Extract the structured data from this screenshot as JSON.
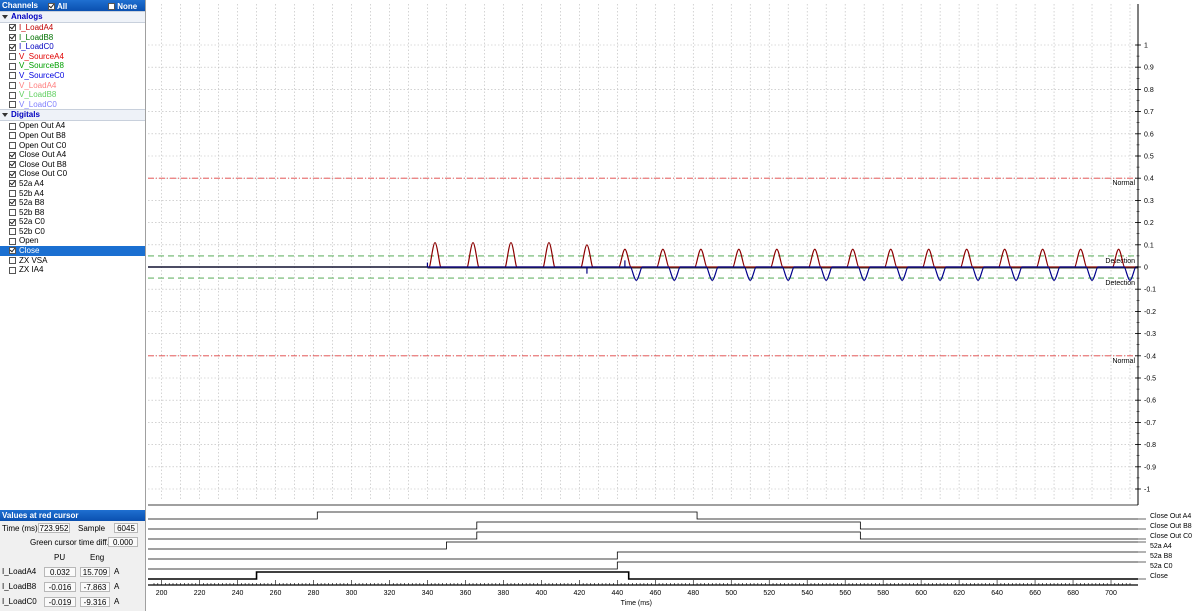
{
  "channels_panel": {
    "title": "Channels",
    "all_label": "All",
    "none_label": "None",
    "analogs_label": "Analogs",
    "analogs": [
      {
        "label": "I_LoadA4",
        "color": "#c00000",
        "checked": true
      },
      {
        "label": "I_LoadB8",
        "color": "#007000",
        "checked": true
      },
      {
        "label": "I_LoadC0",
        "color": "#0000c0",
        "checked": true
      },
      {
        "label": "V_SourceA4",
        "color": "#e00000",
        "checked": false
      },
      {
        "label": "V_SourceB8",
        "color": "#00a000",
        "checked": false
      },
      {
        "label": "V_SourceC0",
        "color": "#0000e0",
        "checked": false
      },
      {
        "label": "V_LoadA4",
        "color": "#ff8080",
        "checked": false
      },
      {
        "label": "V_LoadB8",
        "color": "#60d060",
        "checked": false
      },
      {
        "label": "V_LoadC0",
        "color": "#8080ff",
        "checked": false
      }
    ],
    "digitals_label": "Digitals",
    "digitals": [
      {
        "label": "Open Out A4",
        "checked": false
      },
      {
        "label": "Open Out B8",
        "checked": false
      },
      {
        "label": "Open Out C0",
        "checked": false
      },
      {
        "label": "Close Out A4",
        "checked": true
      },
      {
        "label": "Close Out B8",
        "checked": true
      },
      {
        "label": "Close Out C0",
        "checked": true
      },
      {
        "label": "52a A4",
        "checked": true
      },
      {
        "label": "52b A4",
        "checked": false
      },
      {
        "label": "52a B8",
        "checked": true
      },
      {
        "label": "52b B8",
        "checked": false
      },
      {
        "label": "52a C0",
        "checked": true
      },
      {
        "label": "52b C0",
        "checked": false
      },
      {
        "label": "Open",
        "checked": false
      },
      {
        "label": "Close",
        "checked": true,
        "selected": true
      },
      {
        "label": "ZX VSA",
        "checked": false
      },
      {
        "label": "ZX IA4",
        "checked": false
      }
    ]
  },
  "values_panel": {
    "title": "Values at red cursor",
    "time_label": "Time (ms)",
    "time_value": "723.952",
    "sample_label": "Sample",
    "sample_value": "6045",
    "green_diff_label": "Green cursor time diff.",
    "green_diff_value": "0.000",
    "pu_header": "PU",
    "eng_header": "Eng",
    "rows": [
      {
        "name": "I_LoadA4",
        "pu": "0.032",
        "eng": "15.709",
        "unit": "A"
      },
      {
        "name": "I_LoadB8",
        "pu": "-0.016",
        "eng": "-7.863",
        "unit": "A"
      },
      {
        "name": "I_LoadC0",
        "pu": "-0.019",
        "eng": "-9.316",
        "unit": "A"
      }
    ]
  },
  "chart_data": {
    "type": "line",
    "xlabel": "Time (ms)",
    "x_ticks": [
      200,
      220,
      240,
      260,
      280,
      300,
      320,
      340,
      360,
      380,
      400,
      420,
      440,
      460,
      480,
      500,
      520,
      540,
      560,
      580,
      600,
      620,
      640,
      660,
      680,
      700
    ],
    "xlim": [
      196,
      710
    ],
    "y_ticks": [
      "1",
      "0.9",
      "0.8",
      "0.7",
      "0.6",
      "0.5",
      "0.4",
      "0.3",
      "0.2",
      "0.1",
      "0",
      "-0.1",
      "-0.2",
      "-0.3",
      "-0.4",
      "-0.5",
      "-0.6",
      "-0.7",
      "-0.8",
      "-0.9",
      "-1"
    ],
    "ylim": [
      -1.05,
      1.08
    ],
    "grid": true,
    "threshold_lines": [
      {
        "label": "Normal",
        "value": 0.4,
        "color": "#e04040",
        "style": "dash-dot"
      },
      {
        "label": "Detection",
        "value": 0.05,
        "color": "#40a040",
        "style": "dash"
      },
      {
        "label": "Detection",
        "value": -0.05,
        "color": "#40a040",
        "style": "dash"
      },
      {
        "label": "Normal",
        "value": -0.4,
        "color": "#e04040",
        "style": "dash-dot"
      }
    ],
    "series": [
      {
        "name": "I_LoadA4",
        "color": "#8b0000",
        "pulse_times": [
          344,
          364,
          384,
          404,
          424,
          444,
          464,
          484,
          504,
          524,
          544,
          564,
          584,
          604,
          624,
          644,
          664,
          684,
          704
        ],
        "pulse_heights": [
          0.11,
          0.11,
          0.11,
          0.11,
          0.1,
          0.08,
          0.08,
          0.08,
          0.08,
          0.08,
          0.08,
          0.08,
          0.08,
          0.08,
          0.08,
          0.08,
          0.08,
          0.08,
          0.08
        ]
      },
      {
        "name": "I_LoadB8",
        "color": "#303030"
      },
      {
        "name": "I_LoadC0",
        "color": "#00008b",
        "neg_pulse_times": [
          450,
          470,
          490,
          510,
          530,
          550,
          570,
          590,
          610,
          630,
          650,
          670,
          690,
          710
        ],
        "neg_pulse_depth": -0.06
      }
    ],
    "digital_traces": [
      {
        "label": "Close Out A4",
        "transitions": [
          [
            196,
            0
          ],
          [
            282,
            1
          ],
          [
            482,
            0
          ]
        ]
      },
      {
        "label": "Close Out B8",
        "transitions": [
          [
            196,
            0
          ],
          [
            366,
            1
          ],
          [
            568,
            0
          ]
        ]
      },
      {
        "label": "Close Out C0",
        "transitions": [
          [
            196,
            0
          ],
          [
            366,
            1
          ],
          [
            568,
            0
          ]
        ]
      },
      {
        "label": "52a A4",
        "transitions": [
          [
            196,
            0
          ],
          [
            350,
            1
          ]
        ]
      },
      {
        "label": "52a B8",
        "transitions": [
          [
            196,
            0
          ],
          [
            440,
            1
          ]
        ]
      },
      {
        "label": "52a C0",
        "transitions": [
          [
            196,
            0
          ],
          [
            440,
            1
          ]
        ]
      },
      {
        "label": "Close",
        "transitions": [
          [
            196,
            0
          ],
          [
            250,
            1
          ],
          [
            446,
            0
          ]
        ]
      }
    ]
  }
}
